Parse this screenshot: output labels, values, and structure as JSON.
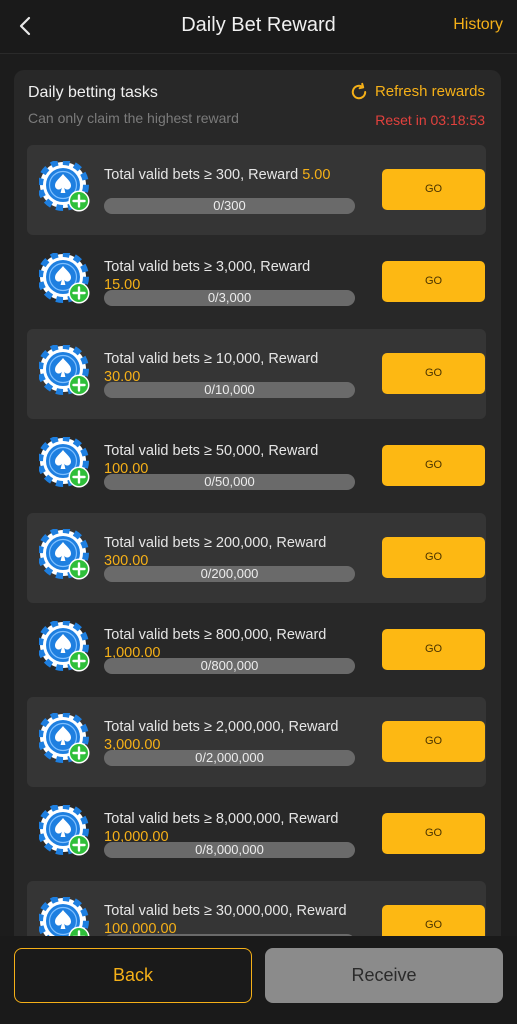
{
  "header": {
    "title": "Daily Bet Reward",
    "history_label": "History",
    "back_icon": "chevron-left-icon"
  },
  "panel": {
    "title": "Daily betting tasks",
    "subtitle": "Can only claim the highest reward",
    "refresh_label": "Refresh rewards",
    "refresh_icon": "refresh-icon",
    "reset_text": "Reset in 03:18:53"
  },
  "tasks": [
    {
      "text": "Total valid bets ≥ 300, Reward",
      "reward": "5.00",
      "progress": "0/300",
      "progress_fraction": 0,
      "button": "GO",
      "icon": "poker-chip-plus-icon"
    },
    {
      "text": "Total valid bets ≥ 3,000, Reward",
      "reward": "15.00",
      "progress": "0/3,000",
      "progress_fraction": 0,
      "button": "GO",
      "icon": "poker-chip-plus-icon"
    },
    {
      "text": "Total valid bets ≥ 10,000, Reward",
      "reward": "30.00",
      "progress": "0/10,000",
      "progress_fraction": 0,
      "button": "GO",
      "icon": "poker-chip-plus-icon"
    },
    {
      "text": "Total valid bets ≥ 50,000, Reward",
      "reward": "100.00",
      "progress": "0/50,000",
      "progress_fraction": 0,
      "button": "GO",
      "icon": "poker-chip-plus-icon"
    },
    {
      "text": "Total valid bets ≥ 200,000, Reward",
      "reward": "300.00",
      "progress": "0/200,000",
      "progress_fraction": 0,
      "button": "GO",
      "icon": "poker-chip-plus-icon"
    },
    {
      "text": "Total valid bets ≥ 800,000, Reward",
      "reward": "1,000.00",
      "progress": "0/800,000",
      "progress_fraction": 0,
      "button": "GO",
      "icon": "poker-chip-plus-icon"
    },
    {
      "text": "Total valid bets ≥ 2,000,000, Reward",
      "reward": "3,000.00",
      "progress": "0/2,000,000",
      "progress_fraction": 0,
      "button": "GO",
      "icon": "poker-chip-plus-icon"
    },
    {
      "text": "Total valid bets ≥ 8,000,000, Reward",
      "reward": "10,000.00",
      "progress": "0/8,000,000",
      "progress_fraction": 0,
      "button": "GO",
      "icon": "poker-chip-plus-icon"
    },
    {
      "text": "Total valid bets ≥ 30,000,000, Reward",
      "reward": "100,000.00",
      "progress": "",
      "progress_fraction": 0,
      "button": "GO",
      "icon": "poker-chip-plus-icon"
    }
  ],
  "footer": {
    "back_label": "Back",
    "receive_label": "Receive"
  },
  "colors": {
    "accent": "#f5b018",
    "reset_red": "#e2413d",
    "button_yellow": "#fdb813",
    "chip_blue": "#1e7fe0",
    "plus_green": "#2fbf3a"
  }
}
